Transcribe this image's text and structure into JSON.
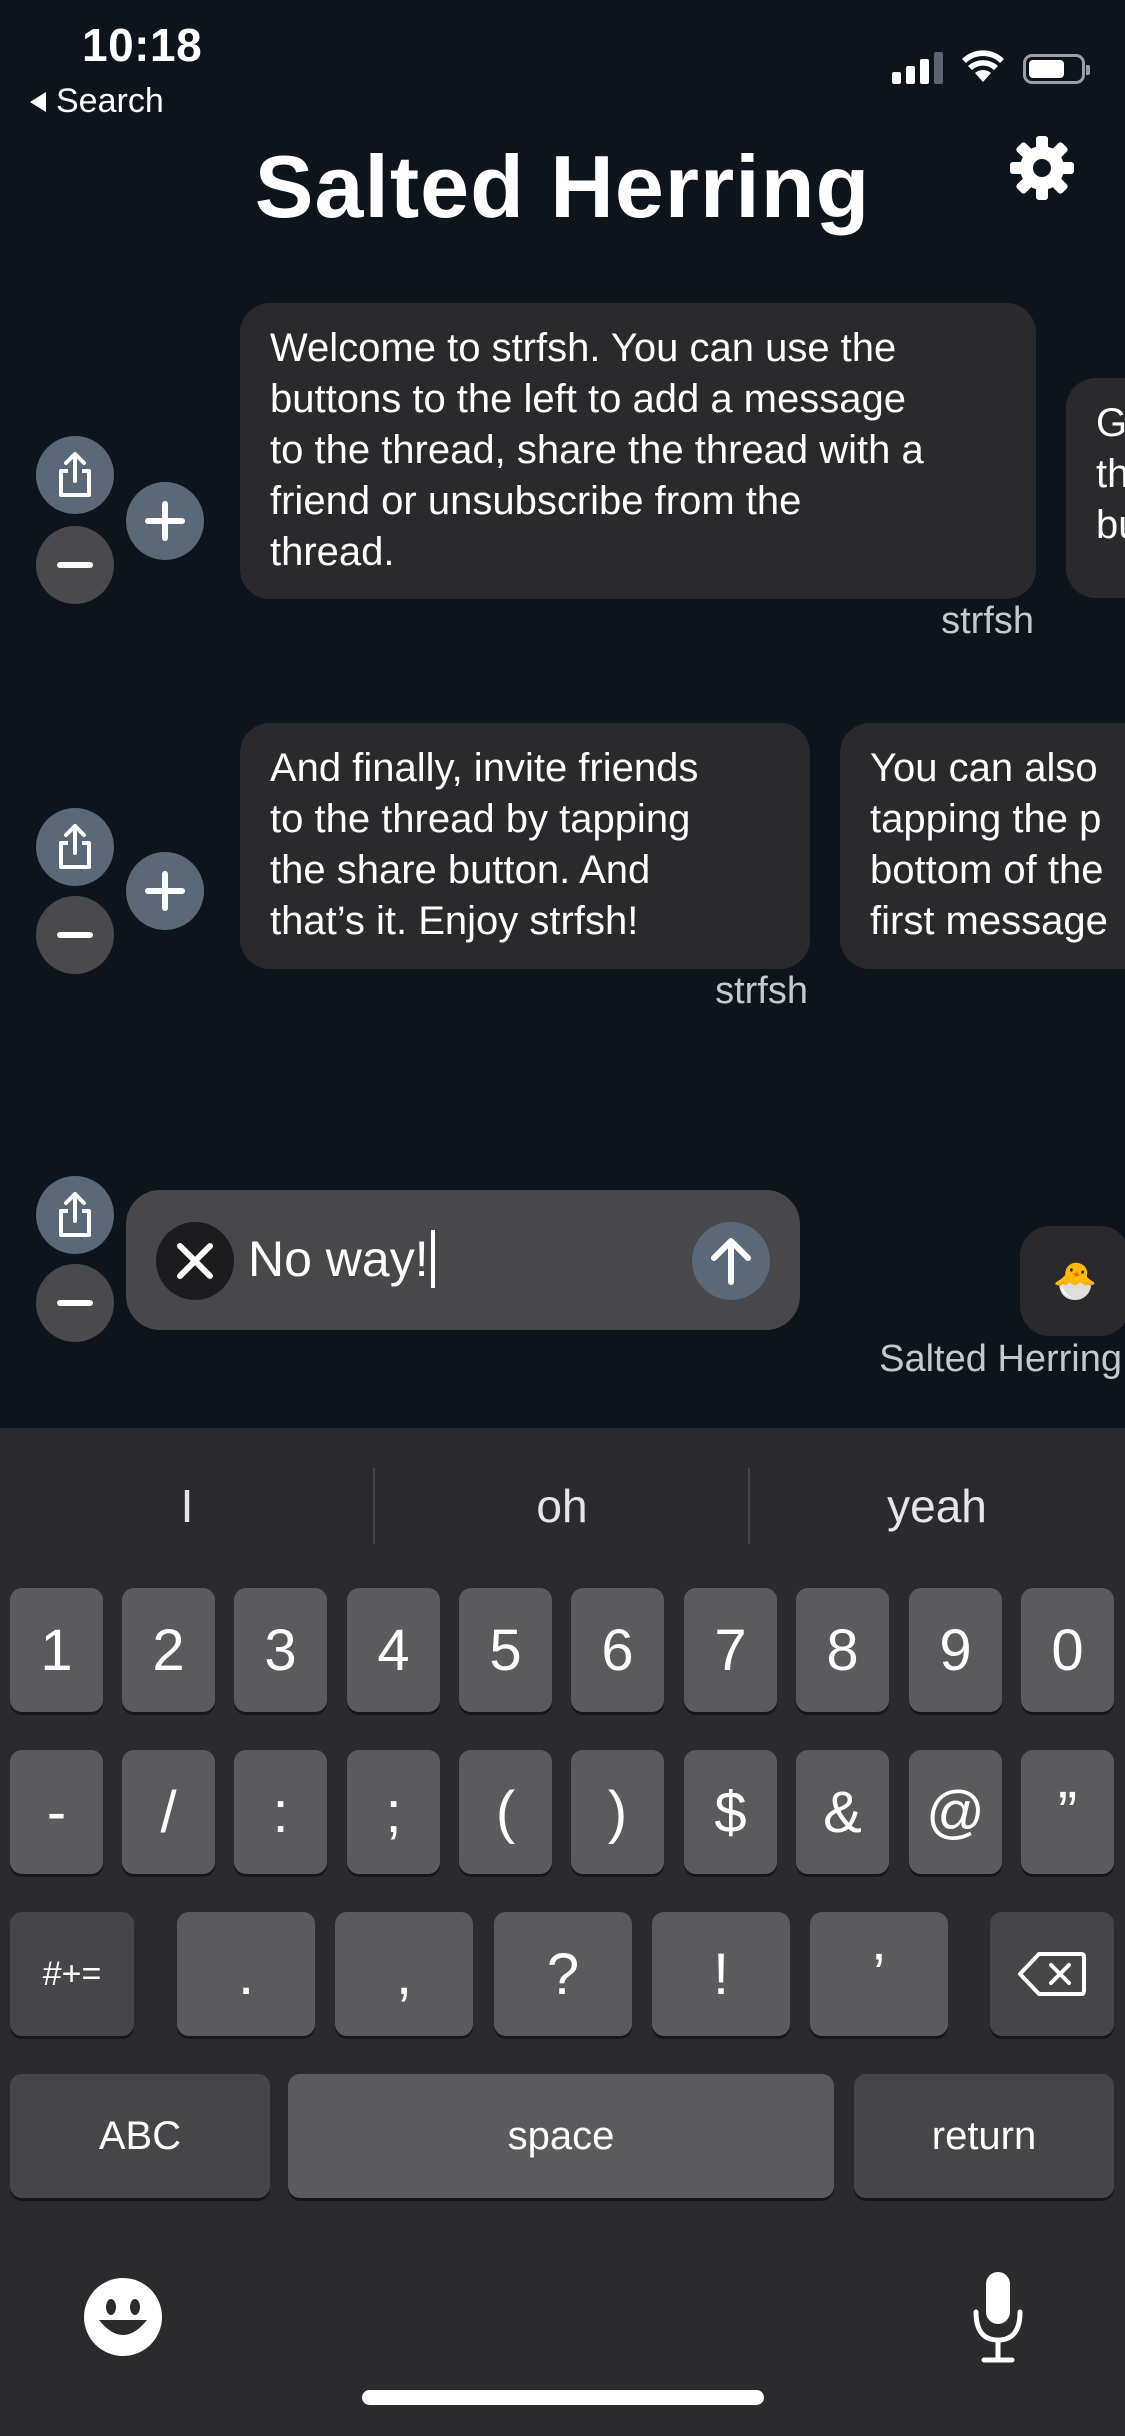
{
  "status_bar": {
    "time": "10:18",
    "back_label": "Search",
    "battery_level": 0.7
  },
  "header": {
    "title": "Salted Herring",
    "settings_icon": "gear-icon"
  },
  "threads": [
    {
      "messages": [
        {
          "lines": [
            "Welcome to strfsh. You can use the",
            "buttons to the left to add a message",
            "to the thread, share the thread with a",
            "friend or unsubscribe from the",
            "thread."
          ],
          "author": "strfsh"
        },
        {
          "lines": [
            "G",
            "th",
            "bu"
          ],
          "author": ""
        }
      ]
    },
    {
      "messages": [
        {
          "lines": [
            "And finally, invite friends",
            "to the thread by tapping",
            "the share button. And",
            "that’s it. Enjoy strfsh!"
          ],
          "author": "strfsh"
        },
        {
          "lines": [
            "You can also",
            "tapping the p",
            "bottom of the",
            "first message"
          ],
          "author": ""
        }
      ]
    }
  ],
  "compose": {
    "text": "No way!",
    "author": "Salted Herring",
    "emoji": "🐣"
  },
  "keyboard": {
    "suggestions": [
      "I",
      "oh",
      "yeah"
    ],
    "row1": [
      "1",
      "2",
      "3",
      "4",
      "5",
      "6",
      "7",
      "8",
      "9",
      "0"
    ],
    "row2": [
      "-",
      "/",
      ":",
      ";",
      "(",
      ")",
      "$",
      "&",
      "@",
      "”"
    ],
    "row3": {
      "mode_key": "#+=",
      "keys": [
        ".",
        ",",
        "?",
        "!",
        "’"
      ]
    },
    "row4": {
      "abc": "ABC",
      "space": "space",
      "return": "return"
    }
  }
}
